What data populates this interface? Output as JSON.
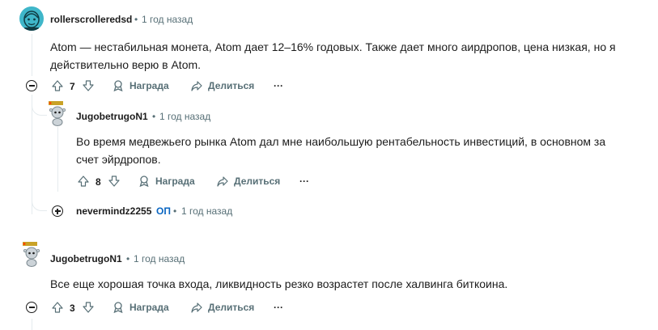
{
  "comments": [
    {
      "username": "rollerscrolleredsd",
      "time": "1 год назад",
      "text": "Atom — нестабильная монета, Atom дает 12–16% годовых. Также дает много аирдропов, цена низкая, но я действительно верю в Atom.",
      "votes": "7",
      "award_label": "Награда",
      "share_label": "Делиться",
      "more_label": "···"
    },
    {
      "username": "JugobetrugoN1",
      "time": "1 год назад",
      "text": "Во время медвежьего рынка Atom дал мне наибольшую рентабельность инвестиций, в основном за счет эйрдропов.",
      "votes": "8",
      "award_label": "Награда",
      "share_label": "Делиться",
      "more_label": "···"
    },
    {
      "username": "nevermindz2255",
      "op_badge": "ОП",
      "time": "1 год назад"
    },
    {
      "username": "JugobetrugoN1",
      "time": "1 год назад",
      "text": "Все еще хорошая точка входа, ликвидность резко возрастет после халвинга биткоина.",
      "votes": "3",
      "award_label": "Награда",
      "share_label": "Делиться",
      "more_label": "···"
    }
  ],
  "separator": "•",
  "colors": {
    "avatar_bg": "#3fb6c9",
    "thread_line": "#e5ebee",
    "op": "#0a66c2"
  }
}
